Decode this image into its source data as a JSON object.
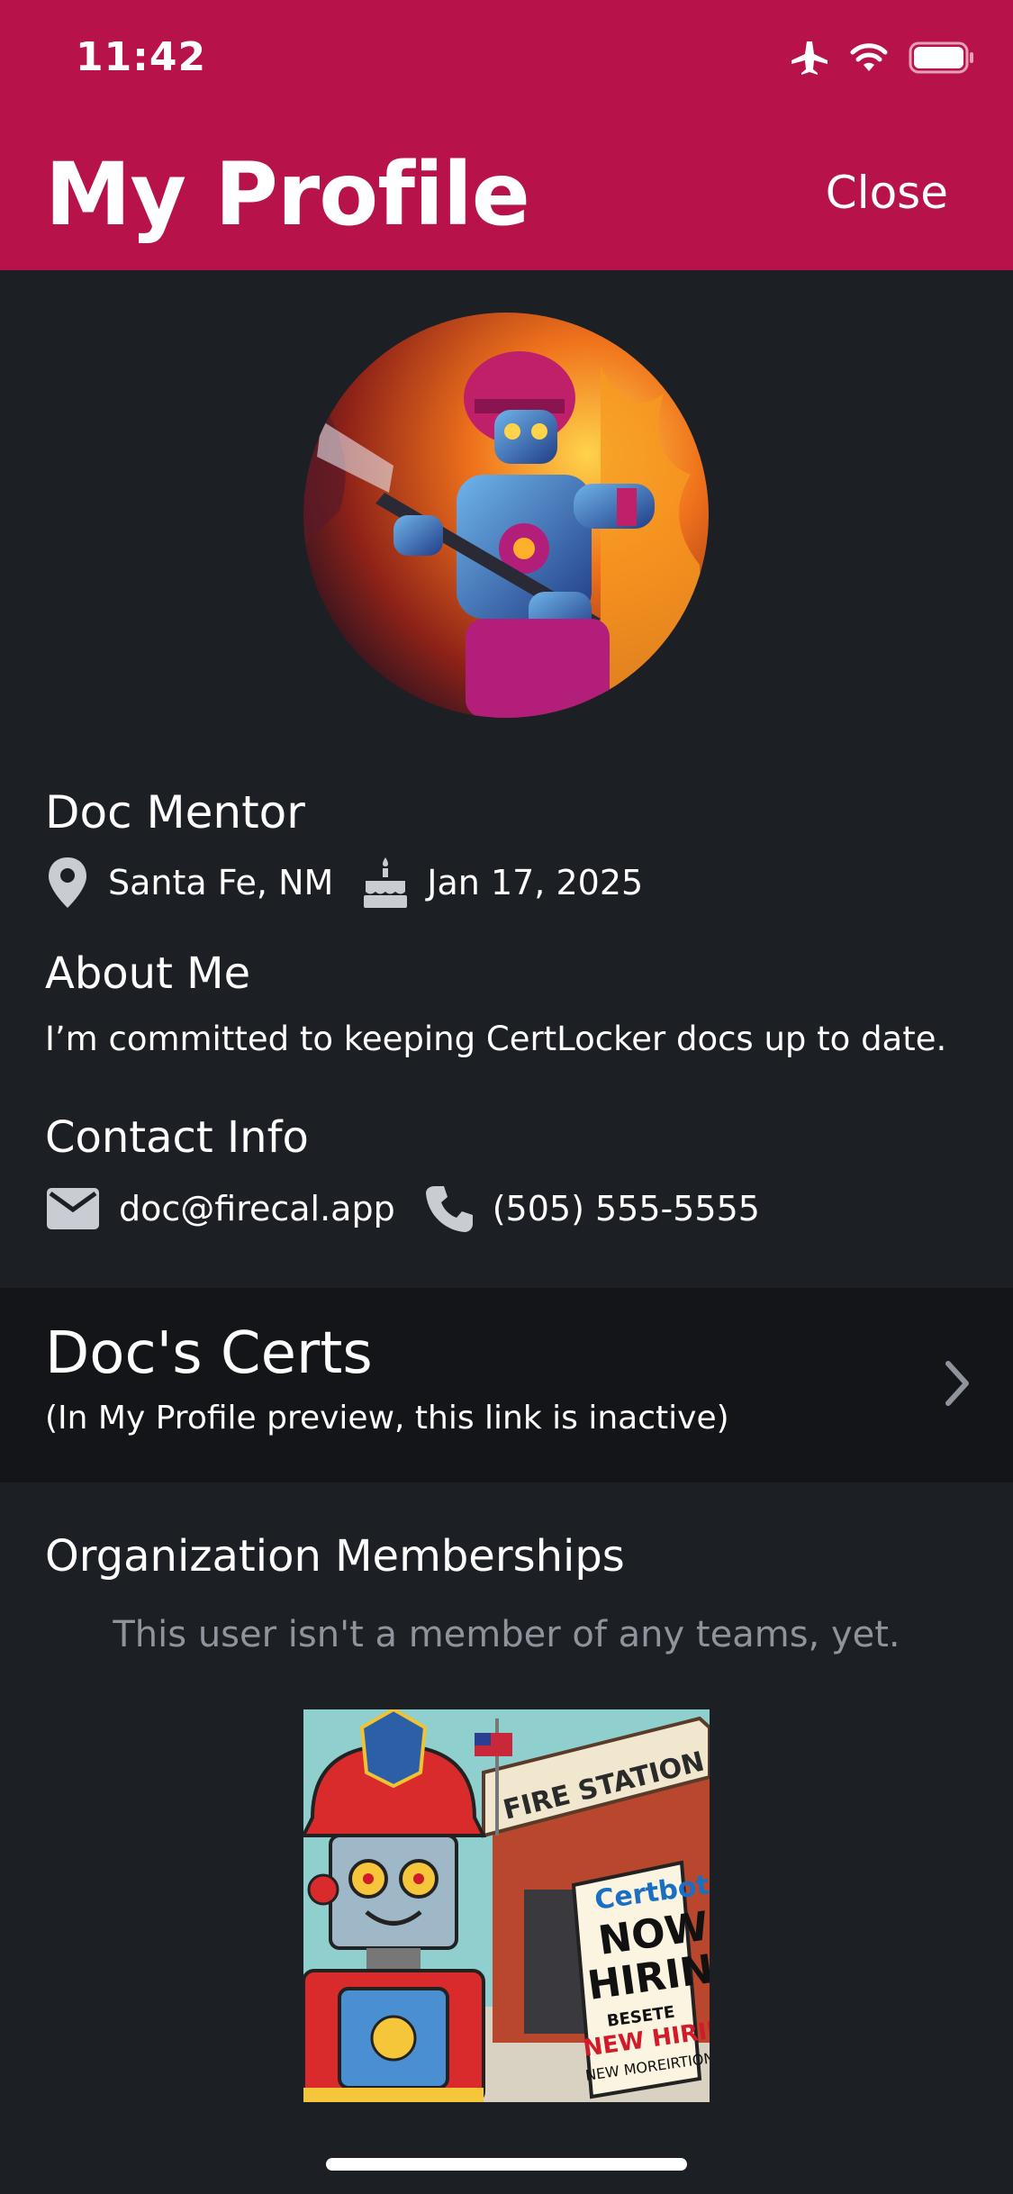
{
  "status_bar": {
    "time": "11:42",
    "icons": [
      "airplane-icon",
      "wifi-icon",
      "battery-icon"
    ]
  },
  "header": {
    "title": "My Profile",
    "close_label": "Close",
    "color": "#b8124a"
  },
  "profile": {
    "name": "Doc Mentor",
    "location": "Santa Fe, NM",
    "birthday": "Jan 17, 2025",
    "about_heading": "About Me",
    "about_text": "I’m committed to keeping CertLocker docs up to date.",
    "contact_heading": "Contact Info",
    "email": "doc@firecal.app",
    "phone": "(505) 555-5555"
  },
  "certs": {
    "title": "Doc's Certs",
    "subtitle": "(In My Profile preview, this link is inactive)"
  },
  "organizations": {
    "heading": "Organization Memberships",
    "empty_text": "This user isn't a member of any teams, yet."
  },
  "hiring_poster": {
    "station_sign": "FIRE STATION",
    "brand": "Certbot",
    "headline_1": "NOW",
    "headline_2": "HIRING",
    "line_1": "BESETE",
    "line_2": "NEW HIRING!",
    "line_3": "NEW MOREIRTION!"
  },
  "colors": {
    "background": "#1c1f24",
    "card": "#131518",
    "muted_text": "#8f939c",
    "icon_gray": "#c9ccd2"
  }
}
